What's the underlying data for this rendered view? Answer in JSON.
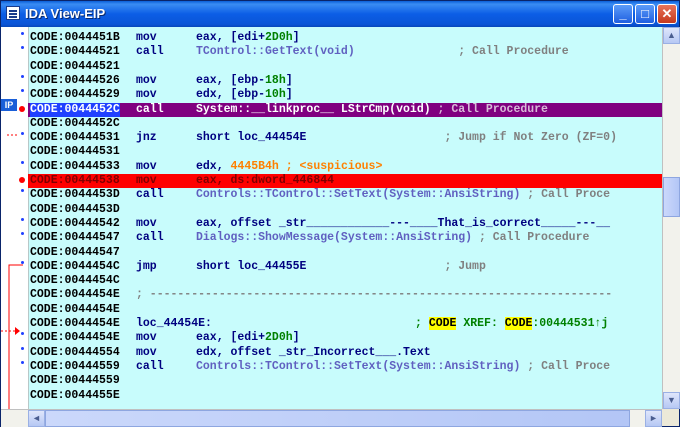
{
  "window": {
    "title": "IDA View-EIP",
    "minimize": "_",
    "maximize": "□",
    "close": "✕"
  },
  "ip_marker": "IP",
  "lines": [
    {
      "addr": "CODE:0044451B",
      "mnem": "mov",
      "ops": [
        {
          "t": "eax, [edi+",
          "c": "#000080"
        },
        {
          "t": "2D0h",
          "c": "#008000"
        },
        {
          "t": "]",
          "c": "#000080"
        }
      ]
    },
    {
      "addr": "CODE:00444521",
      "mnem": "call",
      "ops": [
        {
          "t": "TControl::GetText(void)",
          "c": "#6060c0"
        },
        {
          "t": "               ; Call Procedure",
          "c": "#808080"
        }
      ]
    },
    {
      "addr": "CODE:00444521",
      "mnem": "",
      "ops": []
    },
    {
      "addr": "CODE:00444526",
      "mnem": "mov",
      "ops": [
        {
          "t": "eax, [ebp-",
          "c": "#000080"
        },
        {
          "t": "18h",
          "c": "#008000"
        },
        {
          "t": "]",
          "c": "#000080"
        }
      ]
    },
    {
      "addr": "CODE:00444529",
      "mnem": "mov",
      "ops": [
        {
          "t": "edx, [ebp-",
          "c": "#000080"
        },
        {
          "t": "10h",
          "c": "#008000"
        },
        {
          "t": "]",
          "c": "#000080"
        }
      ]
    },
    {
      "addr": "CODE:0044452C",
      "mnem": "call",
      "ops": [
        {
          "t": "System::__linkproc__ LStrCmp(void)",
          "c": "#ffffff"
        },
        {
          "t": " ; Call Procedure",
          "c": "#d8b8d8"
        }
      ],
      "style": "cur"
    },
    {
      "addr": "CODE:0044452C",
      "mnem": "",
      "ops": []
    },
    {
      "addr": "CODE:00444531",
      "mnem": "jnz",
      "ops": [
        {
          "t": "short loc_44454E",
          "c": "#000080"
        },
        {
          "t": "                    ; Jump if Not Zero (ZF=0)",
          "c": "#808080"
        }
      ]
    },
    {
      "addr": "CODE:00444531",
      "mnem": "",
      "ops": []
    },
    {
      "addr": "CODE:00444533",
      "mnem": "mov",
      "ops": [
        {
          "t": "edx, ",
          "c": "#000080"
        },
        {
          "t": "4445B4h",
          "c": "#ff8000"
        },
        {
          "t": " ; <suspicious>",
          "c": "#ff8000"
        }
      ]
    },
    {
      "addr": "CODE:00444538",
      "mnem": "mov",
      "ops": [
        {
          "t": "eax, ds:dword_446844",
          "c": "#800000"
        }
      ],
      "style": "bp"
    },
    {
      "addr": "CODE:0044453D",
      "mnem": "call",
      "ops": [
        {
          "t": "Controls::TControl::SetText(System::AnsiString)",
          "c": "#6060c0"
        },
        {
          "t": " ; Call Proce",
          "c": "#808080"
        }
      ]
    },
    {
      "addr": "CODE:0044453D",
      "mnem": "",
      "ops": []
    },
    {
      "addr": "CODE:00444542",
      "mnem": "mov",
      "ops": [
        {
          "t": "eax, offset _str____________---____That_is_correct_____---__",
          "c": "#000080"
        }
      ]
    },
    {
      "addr": "CODE:00444547",
      "mnem": "call",
      "ops": [
        {
          "t": "Dialogs::ShowMessage(System::AnsiString)",
          "c": "#6060c0"
        },
        {
          "t": " ; Call Procedure",
          "c": "#808080"
        }
      ]
    },
    {
      "addr": "CODE:00444547",
      "mnem": "",
      "ops": []
    },
    {
      "addr": "CODE:0044454C",
      "mnem": "jmp",
      "ops": [
        {
          "t": "short loc_44455E",
          "c": "#000080"
        },
        {
          "t": "                    ; Jump",
          "c": "#808080"
        }
      ]
    },
    {
      "addr": "CODE:0044454C",
      "mnem": "",
      "ops": []
    },
    {
      "addr": "CODE:0044454E",
      "mnem": "",
      "ops": [
        {
          "t": "; -------------------------------------------------------------------",
          "c": "#808080"
        }
      ],
      "raw": true
    },
    {
      "addr": "CODE:0044454E",
      "mnem": "",
      "ops": []
    },
    {
      "addr": "CODE:0044454E",
      "mnem": "loc_44454E:",
      "ops": [
        {
          "t": "                              ; ",
          "c": "#008000"
        },
        {
          "t": "CODE",
          "c": "#000000",
          "bg": "#ffff00"
        },
        {
          "t": " XREF: ",
          "c": "#008000"
        },
        {
          "t": "CODE",
          "c": "#000000",
          "bg": "#ffff00"
        },
        {
          "t": ":00444531↑j",
          "c": "#008000"
        }
      ],
      "label": true
    },
    {
      "addr": "CODE:0044454E",
      "mnem": "mov",
      "ops": [
        {
          "t": "eax, [edi+",
          "c": "#000080"
        },
        {
          "t": "2D0h",
          "c": "#008000"
        },
        {
          "t": "]",
          "c": "#000080"
        }
      ]
    },
    {
      "addr": "CODE:00444554",
      "mnem": "mov",
      "ops": [
        {
          "t": "edx, offset _str_Incorrect___.Text",
          "c": "#000080"
        }
      ]
    },
    {
      "addr": "CODE:00444559",
      "mnem": "call",
      "ops": [
        {
          "t": "Controls::TControl::SetText(System::AnsiString)",
          "c": "#6060c0"
        },
        {
          "t": " ; Call Proce",
          "c": "#808080"
        }
      ]
    },
    {
      "addr": "CODE:00444559",
      "mnem": "",
      "ops": []
    },
    {
      "addr": "CODE:0044455E",
      "mnem": "",
      "ops": []
    }
  ],
  "scrollbars": {
    "left_arrow": "◄",
    "right_arrow": "►",
    "up_arrow": "▲",
    "down_arrow": "▼"
  },
  "colors": {
    "code_bg": "#c8fcfc",
    "current_line": "#800080",
    "breakpoint_line": "#ff0000"
  }
}
